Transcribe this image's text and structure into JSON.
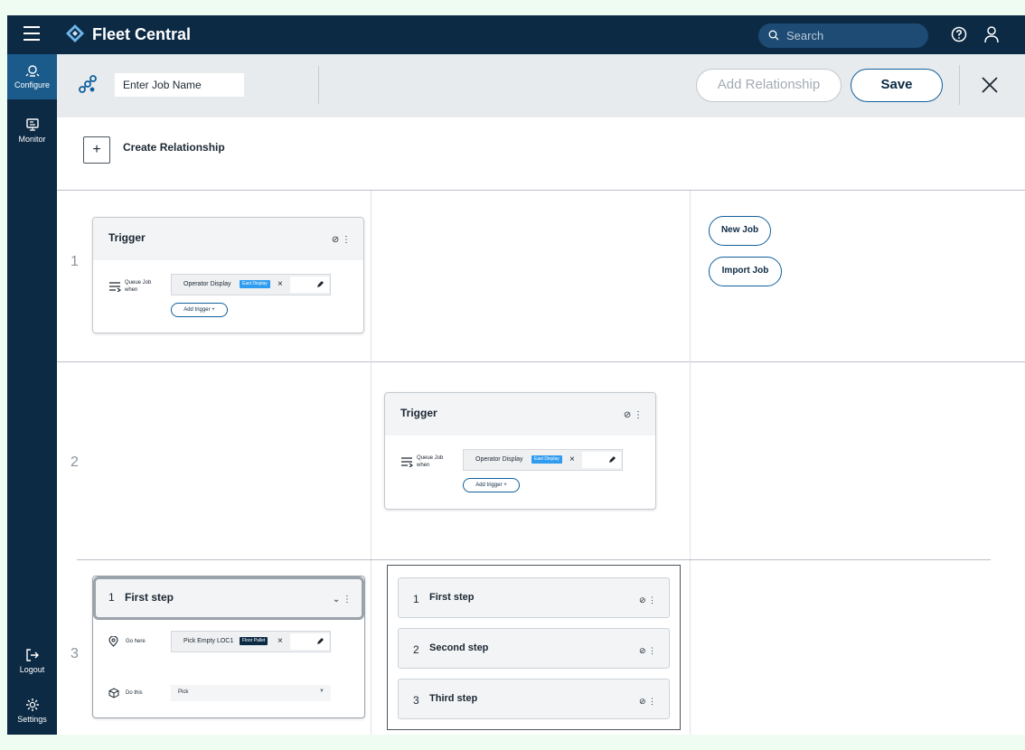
{
  "app": {
    "title": "Fleet Central"
  },
  "search": {
    "placeholder": "Search"
  },
  "topbar_icons": [
    "menu-icon",
    "logo-icon",
    "search-icon",
    "help-icon",
    "user-icon"
  ],
  "sidebar": {
    "items": [
      {
        "label": "Configure",
        "icon": "configure-icon",
        "active": true
      },
      {
        "label": "Monitor",
        "icon": "monitor-icon",
        "active": false
      },
      {
        "label": "Logout",
        "icon": "logout-icon",
        "active": false
      },
      {
        "label": "Settings",
        "icon": "gear-icon",
        "active": false
      }
    ]
  },
  "jobbar": {
    "job_name_placeholder": "Enter Job Name",
    "add_relationship_label": "Add Relationship",
    "save_label": "Save"
  },
  "create_relationship_label": "Create Relationship",
  "rows": [
    {
      "number": "1",
      "trigger": {
        "title": "Trigger",
        "queue_label_line1": "Queue Job",
        "queue_label_line2": "when",
        "chip_text": "Operator Display",
        "chip_badge": "East Display",
        "add_trigger_label": "Add trigger"
      },
      "actions": {
        "new_job_label": "New Job",
        "import_job_label": "Import Job"
      }
    },
    {
      "number": "2",
      "trigger": {
        "title": "Trigger",
        "queue_label_line1": "Queue Job",
        "queue_label_line2": "when",
        "chip_text": "Operator Display",
        "chip_badge": "East Display",
        "add_trigger_label": "Add trigger"
      }
    },
    {
      "number": "3",
      "expanded_step": {
        "number": "1",
        "title": "First step",
        "go_label": "Go here",
        "go_value": "Pick Empty LOC1",
        "go_badge": "Floor Pallet",
        "do_label": "Do this",
        "do_value": "Pick"
      },
      "steps": [
        {
          "number": "1",
          "title": "First step"
        },
        {
          "number": "2",
          "title": "Second step"
        },
        {
          "number": "3",
          "title": "Third step"
        }
      ]
    }
  ],
  "colors": {
    "navy": "#0c2a44",
    "accent": "#0f5f9c",
    "badge_blue": "#2f9cf0",
    "badge_dark": "#0c2a44"
  }
}
